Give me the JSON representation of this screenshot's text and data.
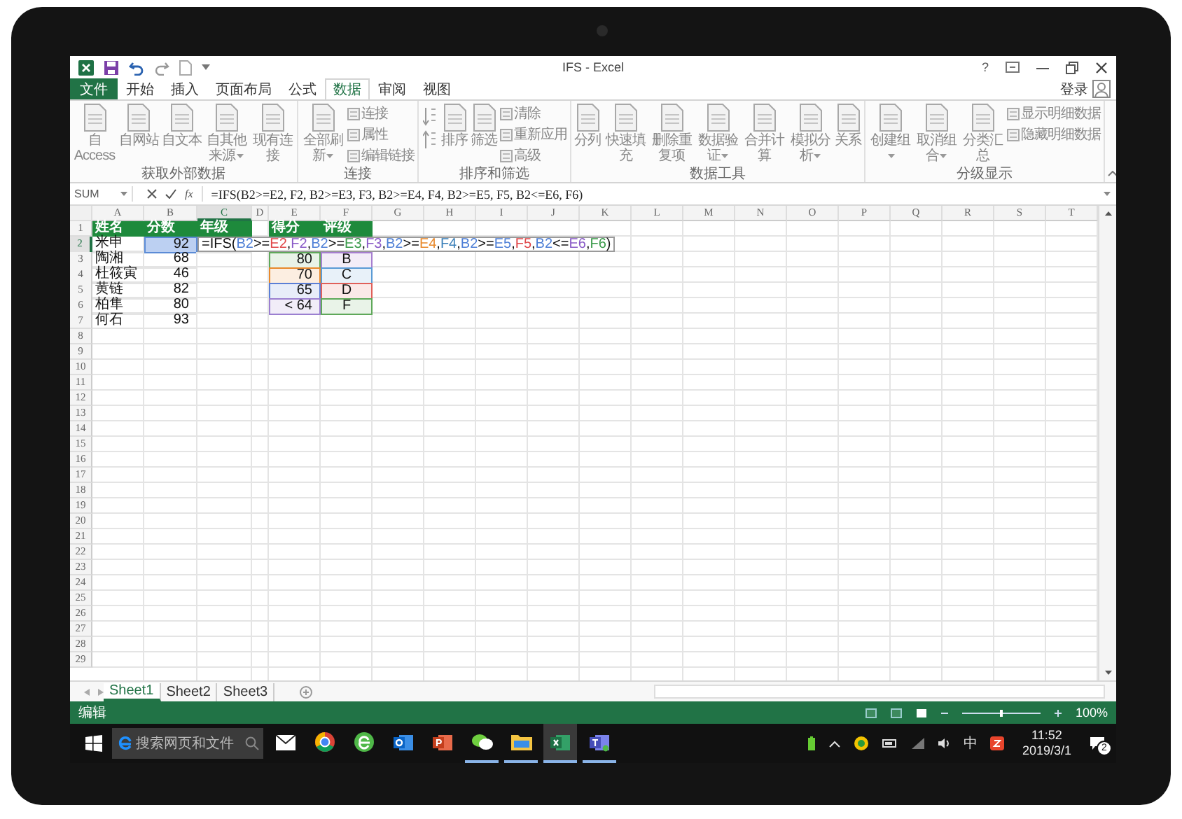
{
  "window": {
    "title": "IFS - Excel",
    "help": "?"
  },
  "menu": {
    "file_tab": "文件",
    "tabs": [
      {
        "label": "开始",
        "selected": false
      },
      {
        "label": "插入",
        "selected": false
      },
      {
        "label": "页面布局",
        "selected": false
      },
      {
        "label": "公式",
        "selected": false
      },
      {
        "label": "数据",
        "selected": true
      },
      {
        "label": "审阅",
        "selected": false
      },
      {
        "label": "视图",
        "selected": false
      }
    ],
    "sign_in": "登录"
  },
  "ribbon": {
    "groups": [
      {
        "label": "获取外部数据",
        "items": [
          {
            "kind": "large",
            "label": "自 Access",
            "dropdown": false
          },
          {
            "kind": "large",
            "label": "自网站",
            "dropdown": false
          },
          {
            "kind": "large",
            "label": "自文本",
            "dropdown": false
          },
          {
            "kind": "large",
            "label": "自其他来源",
            "dropdown": true
          },
          {
            "kind": "large",
            "label": "现有连接",
            "dropdown": false
          }
        ]
      },
      {
        "label": "连接",
        "items": [
          {
            "kind": "large",
            "label": "全部刷新",
            "dropdown": true
          },
          {
            "kind": "stack",
            "labels": [
              "连接",
              "属性",
              "编辑链接"
            ]
          }
        ]
      },
      {
        "label": "排序和筛选",
        "items": [
          {
            "kind": "sort"
          },
          {
            "kind": "large",
            "label": "排序",
            "dropdown": false
          },
          {
            "kind": "large",
            "label": "筛选",
            "dropdown": false
          },
          {
            "kind": "stack",
            "labels": [
              "清除",
              "重新应用",
              "高级"
            ]
          }
        ]
      },
      {
        "label": "数据工具",
        "items": [
          {
            "kind": "large",
            "label": "分列",
            "dropdown": false
          },
          {
            "kind": "large",
            "label": "快速填充",
            "dropdown": false
          },
          {
            "kind": "large",
            "label": "删除重复项",
            "dropdown": false
          },
          {
            "kind": "large",
            "label": "数据验证",
            "dropdown": true
          },
          {
            "kind": "large",
            "label": "合并计算",
            "dropdown": false
          },
          {
            "kind": "large",
            "label": "模拟分析",
            "dropdown": true
          },
          {
            "kind": "large",
            "label": "关系",
            "dropdown": false
          }
        ]
      },
      {
        "label": "分级显示",
        "items": [
          {
            "kind": "large",
            "label": "创建组",
            "dropdown": true
          },
          {
            "kind": "large",
            "label": "取消组合",
            "dropdown": true
          },
          {
            "kind": "large",
            "label": "分类汇总",
            "dropdown": false
          },
          {
            "kind": "stack",
            "labels": [
              "显示明细数据",
              "隐藏明细数据"
            ]
          }
        ]
      }
    ]
  },
  "formula_bar": {
    "name_box": "SUM",
    "fx": "fx",
    "formula": "=IFS(B2>=E2, F2, B2>=E3, F3, B2>=E4, F4, B2>=E5, F5, B2<=E6, F6)"
  },
  "sheet": {
    "columns": [
      {
        "label": "A",
        "selected": false
      },
      {
        "label": "B",
        "selected": false
      },
      {
        "label": "C",
        "selected": true
      },
      {
        "label": "D",
        "selected": false
      },
      {
        "label": "E",
        "selected": false
      },
      {
        "label": "F",
        "selected": false
      },
      {
        "label": "G",
        "selected": false
      },
      {
        "label": "H",
        "selected": false
      },
      {
        "label": "I",
        "selected": false
      },
      {
        "label": "J",
        "selected": false
      },
      {
        "label": "K",
        "selected": false
      },
      {
        "label": "L",
        "selected": false
      },
      {
        "label": "M",
        "selected": false
      },
      {
        "label": "N",
        "selected": false
      },
      {
        "label": "O",
        "selected": false
      },
      {
        "label": "P",
        "selected": false
      },
      {
        "label": "Q",
        "selected": false
      },
      {
        "label": "R",
        "selected": false
      },
      {
        "label": "S",
        "selected": false
      },
      {
        "label": "T",
        "selected": false
      }
    ],
    "rows": [
      {
        "label": "1",
        "selected": false
      },
      {
        "label": "2",
        "selected": true
      },
      {
        "label": "3",
        "selected": false
      },
      {
        "label": "4",
        "selected": false
      },
      {
        "label": "5",
        "selected": false
      },
      {
        "label": "6",
        "selected": false
      },
      {
        "label": "7",
        "selected": false
      },
      {
        "label": "8",
        "selected": false
      },
      {
        "label": "9",
        "selected": false
      },
      {
        "label": "10",
        "selected": false
      },
      {
        "label": "11",
        "selected": false
      },
      {
        "label": "12",
        "selected": false
      },
      {
        "label": "13",
        "selected": false
      },
      {
        "label": "14",
        "selected": false
      },
      {
        "label": "15",
        "selected": false
      },
      {
        "label": "16",
        "selected": false
      },
      {
        "label": "17",
        "selected": false
      },
      {
        "label": "18",
        "selected": false
      },
      {
        "label": "19",
        "selected": false
      },
      {
        "label": "20",
        "selected": false
      },
      {
        "label": "21",
        "selected": false
      },
      {
        "label": "22",
        "selected": false
      },
      {
        "label": "23",
        "selected": false
      },
      {
        "label": "24",
        "selected": false
      },
      {
        "label": "25",
        "selected": false
      },
      {
        "label": "26",
        "selected": false
      },
      {
        "label": "27",
        "selected": false
      },
      {
        "label": "28",
        "selected": false
      },
      {
        "label": "29",
        "selected": false
      }
    ],
    "table_1": {
      "headers": [
        "姓名",
        "分数",
        "年级"
      ],
      "rows": [
        {
          "name": "米申",
          "score": "92",
          "highlighted": true
        },
        {
          "name": "陶湘",
          "score": "68",
          "highlighted": false
        },
        {
          "name": "杜筱寅",
          "score": "46",
          "highlighted": false
        },
        {
          "name": "黄链",
          "score": "82",
          "highlighted": false
        },
        {
          "name": "柏隼",
          "score": "80",
          "highlighted": false
        },
        {
          "name": "何石",
          "score": "93",
          "highlighted": false
        }
      ]
    },
    "table_2": {
      "headers": [
        "得分",
        "评级"
      ],
      "rows": [
        {
          "score": {
            "text": "80",
            "color": "#5fa85a"
          },
          "grade": {
            "text": "B",
            "color": "#a77fd0"
          }
        },
        {
          "score": {
            "text": "70",
            "color": "#e8892b"
          },
          "grade": {
            "text": "C",
            "color": "#5b9bd5"
          }
        },
        {
          "score": {
            "text": "65",
            "color": "#5b7fd6"
          },
          "grade": {
            "text": "D",
            "color": "#e0605a"
          }
        },
        {
          "score": {
            "text": "< 64",
            "color": "#9b7fd0"
          },
          "grade": {
            "text": "F",
            "color": "#5fa85a"
          }
        }
      ]
    },
    "editing_cell": {
      "tokens": [
        {
          "text": "=IFS("
        },
        {
          "text": "B2",
          "color": "#4e7fd6"
        },
        {
          "text": ">="
        },
        {
          "text": "E2",
          "color": "#e0484a"
        },
        {
          "text": ","
        },
        {
          "text": "F2",
          "color": "#8a5bc7"
        },
        {
          "text": ","
        },
        {
          "text": "B2",
          "color": "#4e7fd6"
        },
        {
          "text": ">="
        },
        {
          "text": "E3",
          "color": "#3a9a4a"
        },
        {
          "text": ","
        },
        {
          "text": "F3",
          "color": "#8a5bc7"
        },
        {
          "text": ","
        },
        {
          "text": "B2",
          "color": "#4e7fd6"
        },
        {
          "text": ">="
        },
        {
          "text": "E4",
          "color": "#e8892b"
        },
        {
          "text": ","
        },
        {
          "text": "F4",
          "color": "#3a7fb8"
        },
        {
          "text": ","
        },
        {
          "text": "B2",
          "color": "#4e7fd6"
        },
        {
          "text": ">="
        },
        {
          "text": "E5",
          "color": "#4e7fd6"
        },
        {
          "text": ","
        },
        {
          "text": "F5",
          "color": "#e0484a"
        },
        {
          "text": ","
        },
        {
          "text": "B2",
          "color": "#4e7fd6"
        },
        {
          "text": "<="
        },
        {
          "text": "E6",
          "color": "#8a5bc7"
        },
        {
          "text": ","
        },
        {
          "text": "F6",
          "color": "#3a9a4a"
        },
        {
          "text": ")"
        }
      ]
    }
  },
  "sheet_tabs": [
    {
      "label": "Sheet1",
      "selected": true
    },
    {
      "label": "Sheet2",
      "selected": false
    },
    {
      "label": "Sheet3",
      "selected": false
    }
  ],
  "status_bar": {
    "mode": "编辑",
    "zoom_slider": {
      "level": 0.5
    },
    "zoom": "100%"
  },
  "taskbar": {
    "search": {
      "placeholder": "搜索网页和文件"
    },
    "apps": [
      {
        "kind": "mail",
        "running": false,
        "selected": false
      },
      {
        "kind": "ring",
        "running": false,
        "selected": false
      },
      {
        "kind": "green-e",
        "running": false,
        "selected": false
      },
      {
        "kind": "o-tile",
        "running": false,
        "selected": false
      },
      {
        "kind": "p-tile",
        "running": false,
        "selected": false
      },
      {
        "kind": "chat",
        "running": true,
        "selected": false
      },
      {
        "kind": "folder",
        "running": true,
        "selected": false
      },
      {
        "kind": "x-tile",
        "running": true,
        "selected": true
      },
      {
        "kind": "t-tile",
        "running": true,
        "selected": false
      }
    ],
    "ime": "中",
    "time": "11:52",
    "date": "2019/3/1",
    "notifications": "2"
  }
}
